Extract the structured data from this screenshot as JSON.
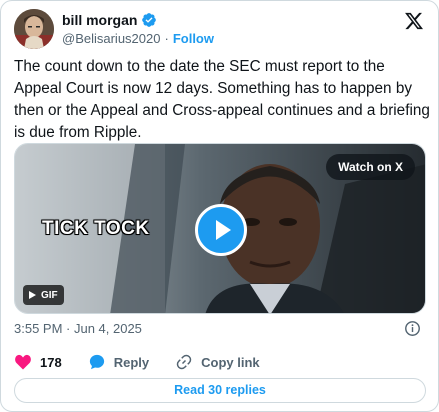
{
  "author": {
    "name": "bill morgan",
    "handle": "@Belisarius2020",
    "separator": "·",
    "follow_label": "Follow"
  },
  "tweet": {
    "text": "The count down to the date the SEC must report to the Appeal Court is now 12 days. Something has to happen by then or the Appeal and Cross-appeal continues and a briefing is due from Ripple."
  },
  "media": {
    "watch_label": "Watch on X",
    "overlay_text": "TICK TOCK",
    "gif_label": "GIF"
  },
  "meta": {
    "timestamp": "3:55 PM · Jun 4, 2025"
  },
  "actions": {
    "like_count": "178",
    "reply_label": "Reply",
    "copy_link_label": "Copy link"
  },
  "read_replies_label": "Read 30 replies",
  "colors": {
    "accent": "#1d9bf0",
    "like": "#f91880",
    "text": "#0f1419",
    "secondary": "#536471",
    "border": "#cfd9de"
  },
  "icons": [
    "verified-badge-icon",
    "x-logo-icon",
    "play-icon",
    "gif-icon",
    "info-icon",
    "heart-icon",
    "reply-icon",
    "link-icon"
  ]
}
